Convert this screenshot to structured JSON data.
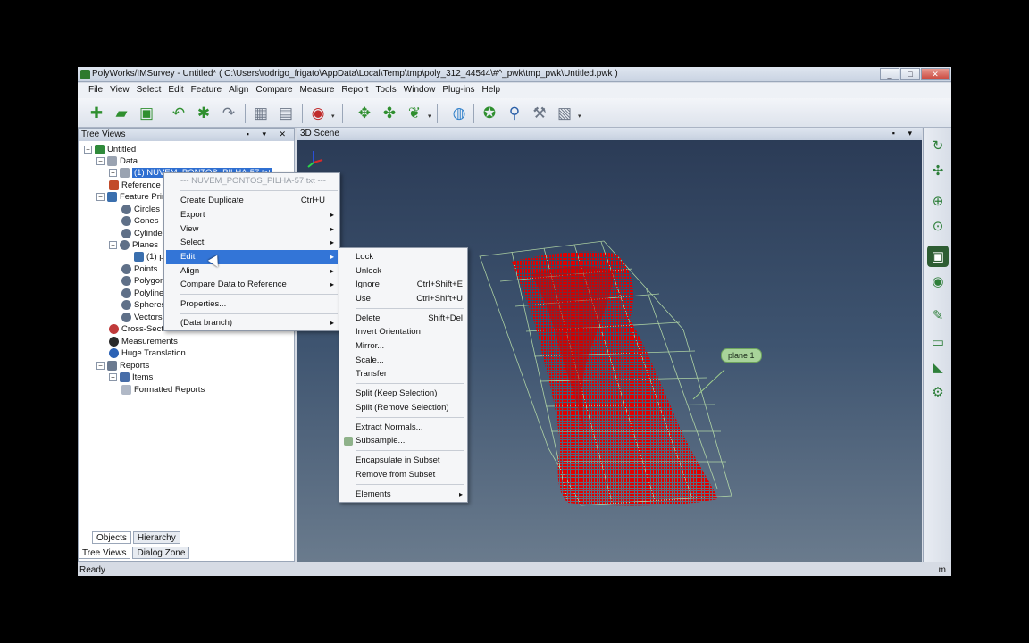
{
  "window": {
    "title": "PolyWorks/IMSurvey - Untitled* ( C:\\Users\\rodrigo_frigato\\AppData\\Local\\Temp\\tmp\\poly_312_44544\\#^_pwk\\tmp_pwk\\Untitled.pwk )",
    "buttons": {
      "minimize": "_",
      "maximize": "□",
      "close": "✕"
    }
  },
  "menubar": [
    "File",
    "View",
    "Select",
    "Edit",
    "Feature",
    "Align",
    "Compare",
    "Measure",
    "Report",
    "Tools",
    "Window",
    "Plug-ins",
    "Help"
  ],
  "tree_panel": {
    "title": "Tree Views",
    "header_buttons": "▪ ▾ ✕",
    "nodes": [
      {
        "label": "Untitled"
      },
      {
        "label": "Data"
      },
      {
        "label": "(1) NUVEM_PONTOS_PILHA-57.txt"
      },
      {
        "label": "Reference"
      },
      {
        "label": "Feature Primitives"
      },
      {
        "label": "Circles"
      },
      {
        "label": "Cones"
      },
      {
        "label": "Cylinders"
      },
      {
        "label": "Planes"
      },
      {
        "label": "(1) plane 1"
      },
      {
        "label": "Points"
      },
      {
        "label": "Polygons"
      },
      {
        "label": "Polylines"
      },
      {
        "label": "Spheres"
      },
      {
        "label": "Vectors"
      },
      {
        "label": "Cross-Sections"
      },
      {
        "label": "Measurements"
      },
      {
        "label": "Huge Translation"
      },
      {
        "label": "Reports"
      },
      {
        "label": "Items"
      },
      {
        "label": "Formatted Reports"
      }
    ],
    "tabs_top": [
      "Objects",
      "Hierarchy"
    ],
    "tabs_bottom": [
      "Tree Views",
      "Dialog Zone"
    ]
  },
  "scene": {
    "title": "3D Scene",
    "header_buttons": "▪ ▾",
    "plane_label": "plane 1",
    "colors": {
      "point_cloud": "#e00000",
      "grid": "#c8f0b0"
    }
  },
  "context_menu": {
    "header": "--- NUVEM_PONTOS_PILHA-57.txt ---",
    "items": [
      {
        "label": "Create Duplicate",
        "shortcut": "Ctrl+U"
      },
      {
        "label": "Export",
        "arrow": "▸"
      },
      {
        "label": "View",
        "arrow": "▸"
      },
      {
        "label": "Select",
        "arrow": "▸"
      },
      {
        "label": "Edit",
        "arrow": "▸"
      },
      {
        "label": "Align",
        "arrow": "▸"
      },
      {
        "label": "Compare Data to Reference",
        "arrow": "▸"
      },
      {
        "label": "Properties..."
      },
      {
        "label": "(Data branch)",
        "arrow": "▸"
      }
    ]
  },
  "edit_submenu": {
    "items": [
      {
        "label": "Lock"
      },
      {
        "label": "Unlock"
      },
      {
        "label": "Ignore",
        "shortcut": "Ctrl+Shift+E"
      },
      {
        "label": "Use",
        "shortcut": "Ctrl+Shift+U"
      },
      {
        "label": "Delete",
        "shortcut": "Shift+Del"
      },
      {
        "label": "Invert Orientation"
      },
      {
        "label": "Mirror..."
      },
      {
        "label": "Scale..."
      },
      {
        "label": "Transfer"
      },
      {
        "label": "Split (Keep Selection)"
      },
      {
        "label": "Split (Remove Selection)"
      },
      {
        "label": "Extract Normals..."
      },
      {
        "label": "Subsample..."
      },
      {
        "label": "Encapsulate in Subset"
      },
      {
        "label": "Remove from Subset"
      },
      {
        "label": "Elements",
        "arrow": "▸"
      }
    ]
  },
  "statusbar": {
    "text": "Ready",
    "unit": "m"
  }
}
